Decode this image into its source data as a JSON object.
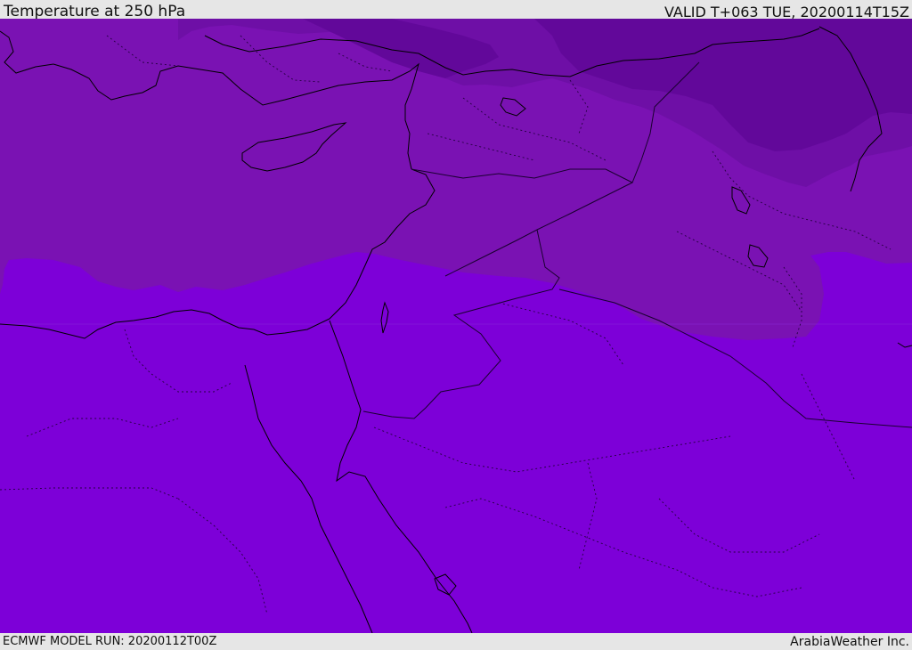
{
  "header": {
    "title": "Temperature at 250 hPa",
    "valid": "VALID T+063 TUE, 20200114T15Z"
  },
  "footer": {
    "model_run": "ECMWF MODEL RUN: 20200112T00Z",
    "credit": "ArabiaWeather Inc."
  },
  "map": {
    "variable": "temperature",
    "level": "250 hPa",
    "region": "Eastern Mediterranean / Middle East",
    "colors": {
      "warmest_band": "#7d00d8",
      "middle_band": "#7a12b3",
      "cool_band": "#6e0fa6",
      "coldest_band": "#62089a",
      "coastline": "#000000",
      "border": "#3a0060"
    }
  }
}
